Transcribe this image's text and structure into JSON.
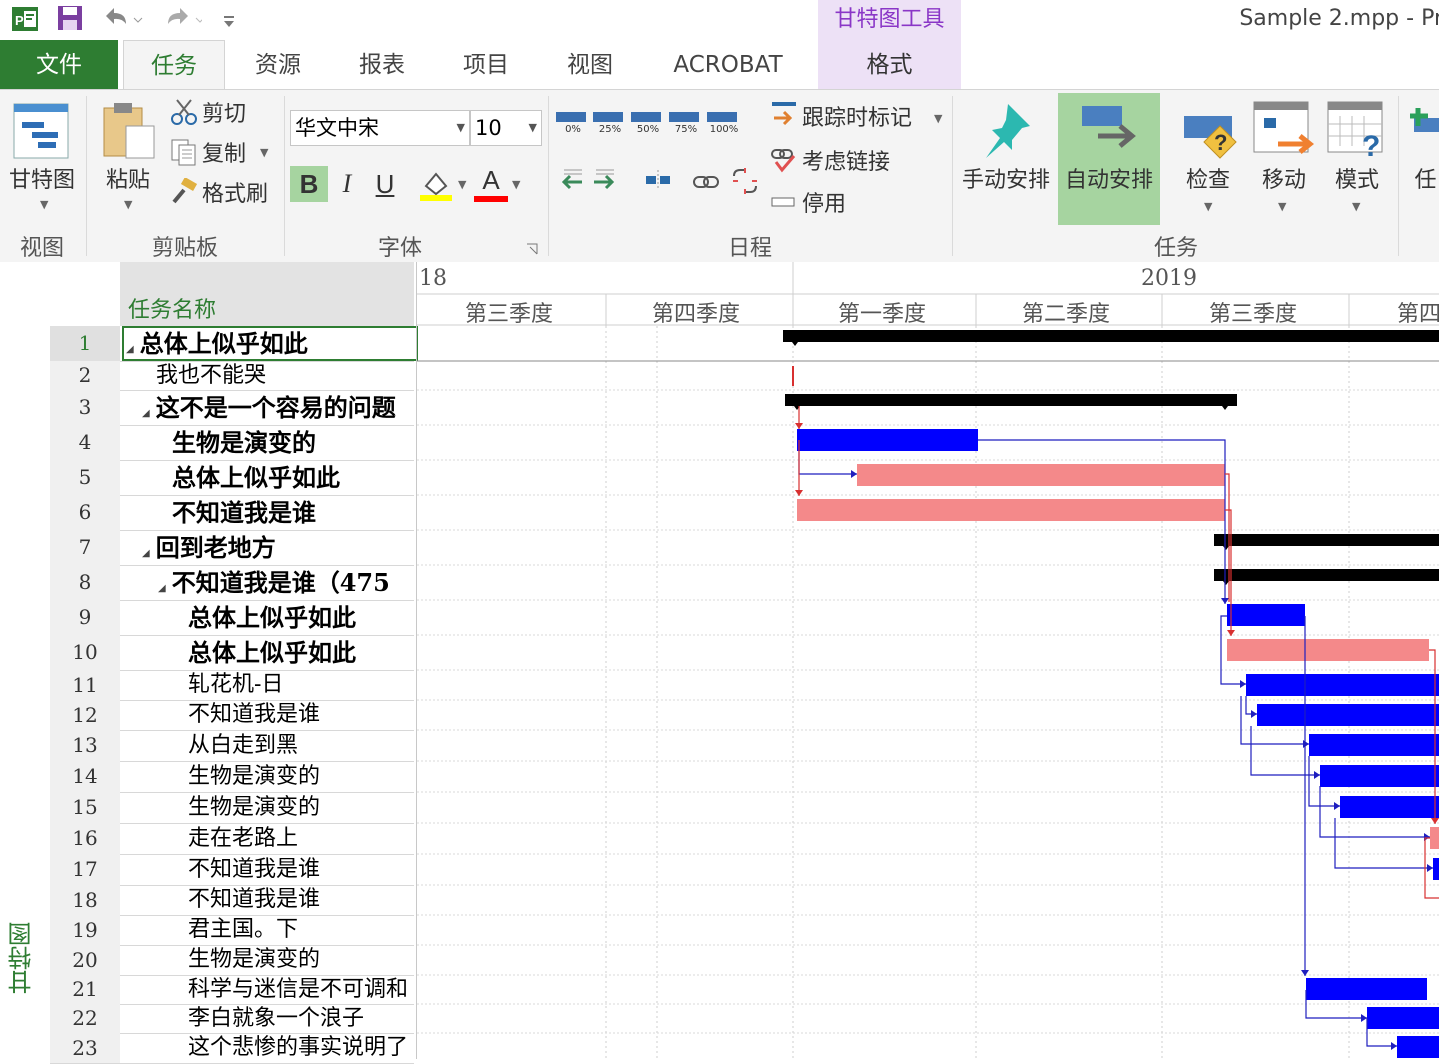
{
  "titlebar": {
    "app_icon": "project-app-icon",
    "context_tab_title": "甘特图工具",
    "window_title": "Sample 2.mpp - Pr"
  },
  "tabs": [
    {
      "label": "文件"
    },
    {
      "label": "任务"
    },
    {
      "label": "资源"
    },
    {
      "label": "报表"
    },
    {
      "label": "项目"
    },
    {
      "label": "视图"
    },
    {
      "label": "ACROBAT"
    },
    {
      "label": "格式"
    }
  ],
  "ribbon": {
    "view_group": {
      "label": "视图",
      "gantt_label": "甘特图"
    },
    "clipboard_group": {
      "label": "剪贴板",
      "paste": "粘贴",
      "cut": "剪切",
      "copy": "复制",
      "format_painter": "格式刷"
    },
    "font_group": {
      "label": "字体",
      "font_name": "华文中宋",
      "font_size": "10",
      "bold": "B",
      "italic": "I",
      "underline": "U",
      "font_color": "A"
    },
    "schedule_group": {
      "label": "日程",
      "percents": [
        "0%",
        "25%",
        "50%",
        "75%",
        "100%"
      ],
      "track": "跟踪时标记",
      "respect_links": "考虑链接",
      "inactivate": "停用"
    },
    "tasks_group": {
      "label": "任务",
      "manual": "手动安排",
      "auto": "自动安排",
      "inspect": "检查",
      "move": "移动",
      "mode": "模式",
      "task": "任"
    }
  },
  "view_bar_label": "甘特图",
  "grid": {
    "name_header": "任务名称",
    "rows": [
      {
        "id": "1",
        "name": "总体上似乎如此",
        "level": 0,
        "summary": true
      },
      {
        "id": "2",
        "name": "我也不能哭",
        "level": 1,
        "summary": false
      },
      {
        "id": "3",
        "name": "这不是一个容易的问题",
        "level": 1,
        "summary": true
      },
      {
        "id": "4",
        "name": "生物是演变的",
        "level": 2,
        "summary": false,
        "bold": true
      },
      {
        "id": "5",
        "name": "总体上似乎如此",
        "level": 2,
        "summary": false,
        "bold": true
      },
      {
        "id": "6",
        "name": "不知道我是谁",
        "level": 2,
        "summary": false,
        "bold": true
      },
      {
        "id": "7",
        "name": "回到老地方",
        "level": 1,
        "summary": true
      },
      {
        "id": "8",
        "name": "不知道我是谁（475",
        "level": 2,
        "summary": true
      },
      {
        "id": "9",
        "name": "总体上似乎如此",
        "level": 3,
        "summary": false,
        "bold": true
      },
      {
        "id": "10",
        "name": "总体上似乎如此",
        "level": 3,
        "summary": false,
        "bold": true
      },
      {
        "id": "11",
        "name": "轧花机-日",
        "level": 3,
        "summary": false
      },
      {
        "id": "12",
        "name": "不知道我是谁",
        "level": 3,
        "summary": false
      },
      {
        "id": "13",
        "name": "从白走到黑",
        "level": 3,
        "summary": false
      },
      {
        "id": "14",
        "name": "生物是演变的",
        "level": 3,
        "summary": false
      },
      {
        "id": "15",
        "name": "生物是演变的",
        "level": 3,
        "summary": false
      },
      {
        "id": "16",
        "name": "走在老路上",
        "level": 3,
        "summary": false
      },
      {
        "id": "17",
        "name": "不知道我是谁",
        "level": 3,
        "summary": false
      },
      {
        "id": "18",
        "name": "不知道我是谁",
        "level": 3,
        "summary": false
      },
      {
        "id": "19",
        "name": "君主国。下",
        "level": 3,
        "summary": false
      },
      {
        "id": "20",
        "name": "生物是演变的",
        "level": 3,
        "summary": false
      },
      {
        "id": "21",
        "name": "科学与迷信是不可调和",
        "level": 3,
        "summary": false
      },
      {
        "id": "22",
        "name": "李白就象一个浪子",
        "level": 3,
        "summary": false
      },
      {
        "id": "23",
        "name": "这个悲惨的事实说明了",
        "level": 3,
        "summary": false
      }
    ]
  },
  "timescale": {
    "years": [
      "18",
      "2019"
    ],
    "quarters": [
      "第三季度",
      "第四季度",
      "第一季度",
      "第二季度",
      "第三季度",
      "第四"
    ]
  },
  "colors": {
    "accent": "#2e7d32",
    "context": "#8a36c7",
    "task_bar": "#0000ff",
    "critical_bar": "#f4898a",
    "summary_bar": "#000000",
    "link_line": "#1f1fbf",
    "critical_link": "#d83030"
  }
}
